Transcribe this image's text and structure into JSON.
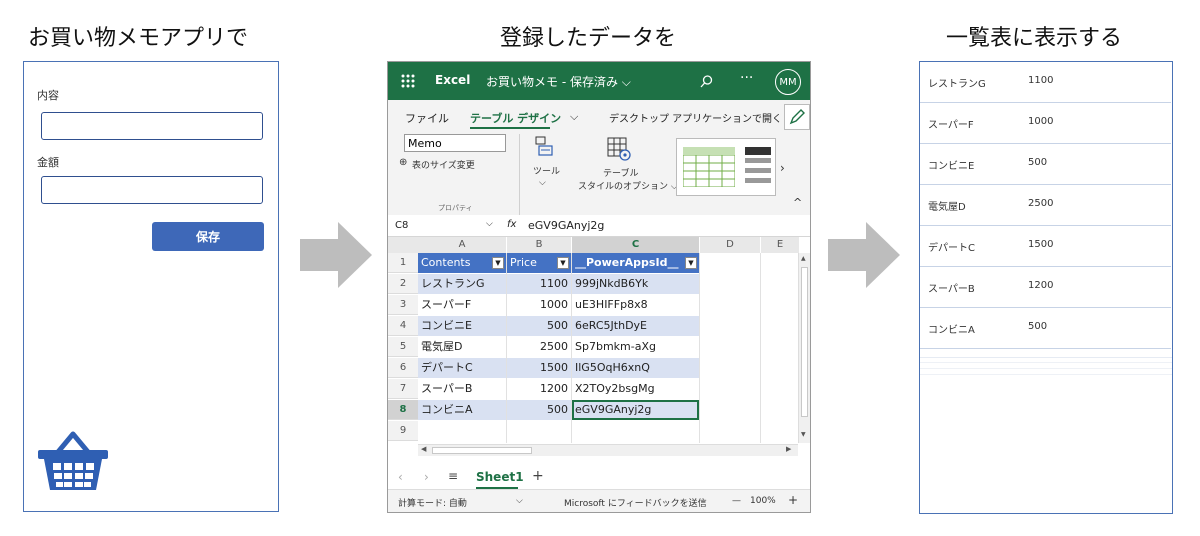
{
  "captions": {
    "left": "お買い物メモアプリで",
    "middle": "登録したデータを",
    "right": "一覧表に表示する"
  },
  "form": {
    "content_label": "内容",
    "content_value": "",
    "amount_label": "金額",
    "amount_value": "",
    "save_label": "保存",
    "basket_icon": "shopping-basket-icon"
  },
  "excel": {
    "app_name": "Excel",
    "file_title": "お買い物メモ - 保存済み ⌵",
    "avatar": "MM",
    "tabs": [
      "ファイル",
      "テーブル デザイン",
      "デスクトップ アプリケーションで開く"
    ],
    "table_name_value": "Memo",
    "resize_label": "表のサイズ変更",
    "properties_label": "プロパティ",
    "tools_label": "ツール",
    "style_options_label_1": "テーブル",
    "style_options_label_2": "スタイルのオプション ⌵",
    "cell_ref": "C8",
    "fx": "fx",
    "formula_value": "eGV9GAnyj2g",
    "columns": [
      "A",
      "B",
      "C",
      "D",
      "E"
    ],
    "headers": [
      "Contents",
      "Price",
      "__PowerAppsId__"
    ],
    "rows": [
      {
        "n": "2",
        "a": "レストランG",
        "b": "1100",
        "c": "999jNkdB6Yk"
      },
      {
        "n": "3",
        "a": "スーパーF",
        "b": "1000",
        "c": "uE3HIFFp8x8"
      },
      {
        "n": "4",
        "a": "コンビニE",
        "b": "500",
        "c": "6eRC5JthDyE"
      },
      {
        "n": "5",
        "a": "電気屋D",
        "b": "2500",
        "c": "Sp7bmkm-aXg"
      },
      {
        "n": "6",
        "a": "デパートC",
        "b": "1500",
        "c": "IlG5OqH6xnQ"
      },
      {
        "n": "7",
        "a": "スーパーB",
        "b": "1200",
        "c": "X2TOy2bsgMg"
      },
      {
        "n": "8",
        "a": "コンビニA",
        "b": "500",
        "c": "eGV9GAnyj2g"
      }
    ],
    "header_row_num": "1",
    "empty_row_num": "9",
    "sheet_name": "Sheet1",
    "add_sheet": "+",
    "status_calc": "計算モード: 自動",
    "status_feedback": "Microsoft にフィードバックを送信",
    "zoom": "100%",
    "zoom_minus": "—",
    "zoom_plus": "+"
  },
  "list": {
    "items": [
      {
        "name": "レストランG",
        "price": "1100"
      },
      {
        "name": "スーパーF",
        "price": "1000"
      },
      {
        "name": "コンビニE",
        "price": "500"
      },
      {
        "name": "電気屋D",
        "price": "2500"
      },
      {
        "name": "デパートC",
        "price": "1500"
      },
      {
        "name": "スーパーB",
        "price": "1200"
      },
      {
        "name": "コンビニA",
        "price": "500"
      }
    ]
  },
  "colors": {
    "excel_green": "#1e7145",
    "panel_border": "#4a72b5",
    "save_button": "#3e68b8",
    "table_header": "#4472c4",
    "table_band": "#d9e1f2",
    "arrow": "#bdbdbd"
  }
}
